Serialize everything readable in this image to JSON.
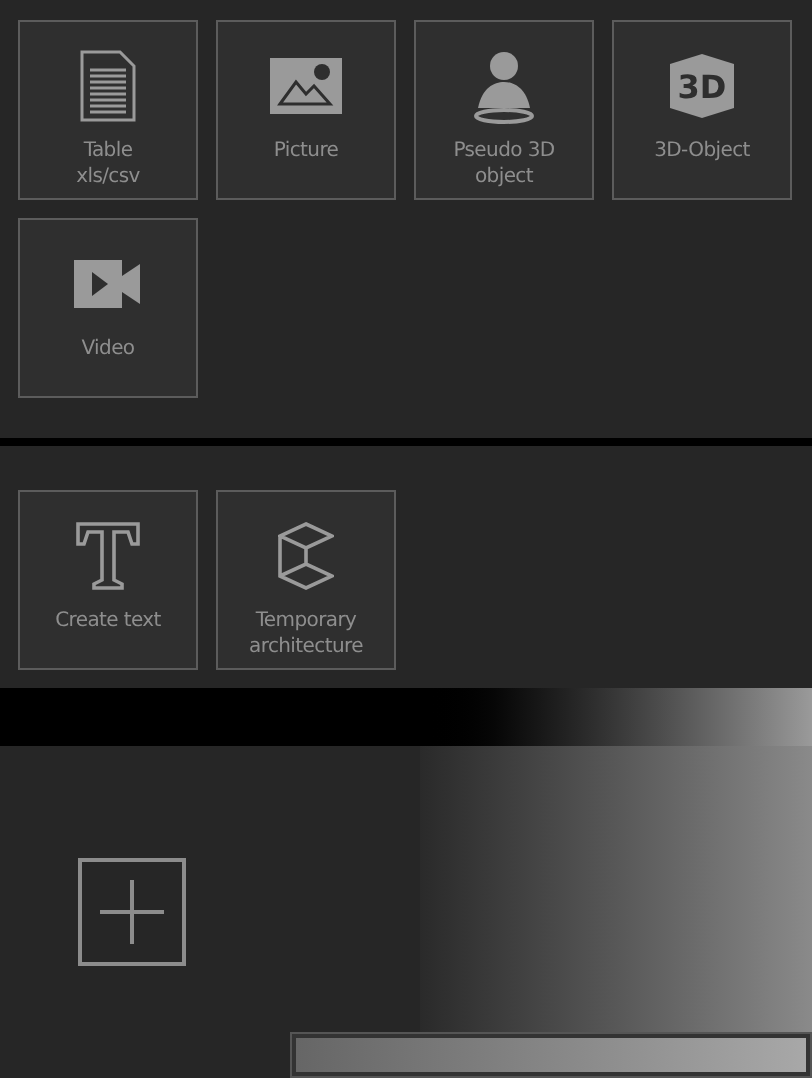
{
  "sections": [
    {
      "items": [
        {
          "kind": "table",
          "label": "Table\nxls/csv"
        },
        {
          "kind": "picture",
          "label": "Picture"
        },
        {
          "kind": "pseudo3d",
          "label": "Pseudo 3D\nobject"
        },
        {
          "kind": "object3d",
          "label": "3D-Object",
          "icon_text": "3D"
        },
        {
          "kind": "video",
          "label": "Video"
        }
      ]
    },
    {
      "items": [
        {
          "kind": "text",
          "label": "Create text"
        },
        {
          "kind": "architecture",
          "label": "Temporary\narchitecture"
        }
      ]
    }
  ]
}
